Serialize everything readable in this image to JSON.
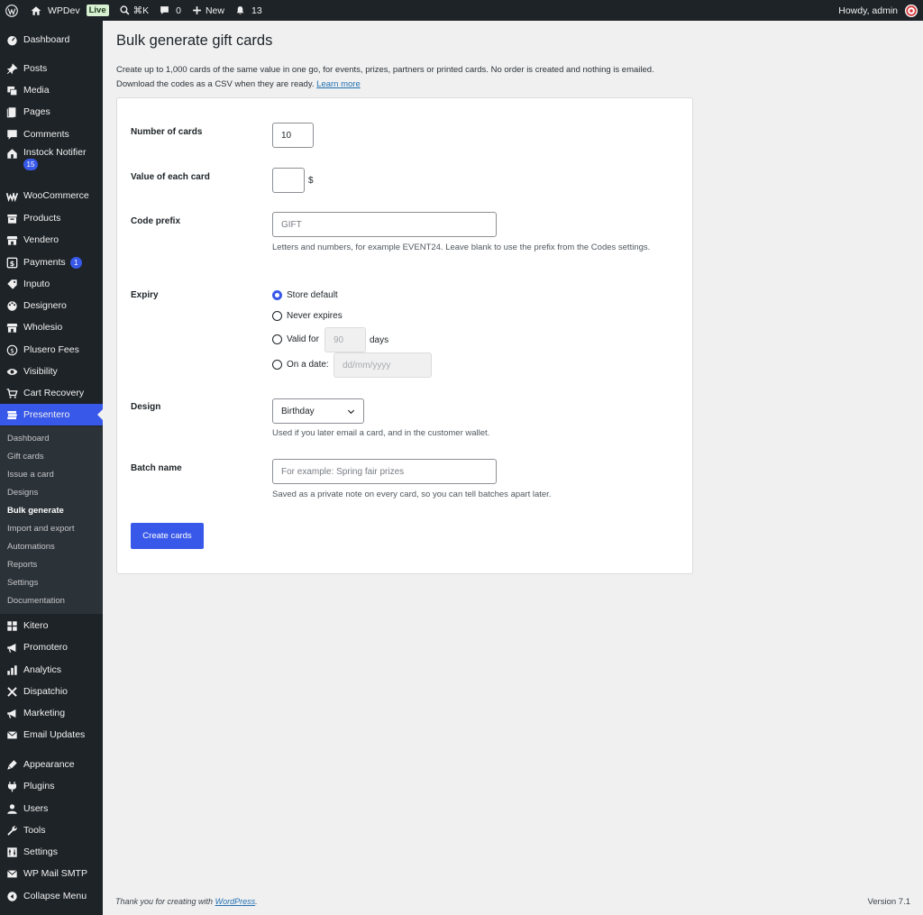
{
  "adminbar": {
    "site_name": "WPDev",
    "live_badge": "Live",
    "shortcut": "⌘K",
    "comments_count": "0",
    "new_label": "New",
    "notifications_count": "13",
    "howdy": "Howdy, admin"
  },
  "sidebar": {
    "items": [
      {
        "label": "Dashboard",
        "icon": "dashboard-icon"
      },
      {
        "label": "Posts",
        "icon": "pin-icon"
      },
      {
        "label": "Media",
        "icon": "media-icon"
      },
      {
        "label": "Pages",
        "icon": "pages-icon"
      },
      {
        "label": "Comments",
        "icon": "comment-icon"
      },
      {
        "label": "Instock Notifier",
        "icon": "store-icon",
        "badge": "15"
      },
      {
        "label": "WooCommerce",
        "icon": "woo-icon"
      },
      {
        "label": "Products",
        "icon": "archive-icon"
      },
      {
        "label": "Vendero",
        "icon": "storefront-icon"
      },
      {
        "label": "Payments",
        "icon": "dollar-box-icon",
        "badge": "1"
      },
      {
        "label": "Inputo",
        "icon": "tag-icon"
      },
      {
        "label": "Designero",
        "icon": "palette-icon"
      },
      {
        "label": "Wholesio",
        "icon": "storefront-icon"
      },
      {
        "label": "Plusero Fees",
        "icon": "dollar-circle-icon"
      },
      {
        "label": "Visibility",
        "icon": "eye-icon"
      },
      {
        "label": "Cart Recovery",
        "icon": "cart-icon"
      },
      {
        "label": "Presentero",
        "icon": "gift-stack-icon"
      },
      {
        "label": "Kitero",
        "icon": "grid-icon"
      },
      {
        "label": "Promotero",
        "icon": "megaphone-icon"
      },
      {
        "label": "Analytics",
        "icon": "bar-chart-icon"
      },
      {
        "label": "Dispatchio",
        "icon": "tools-cross-icon"
      },
      {
        "label": "Marketing",
        "icon": "megaphone-icon"
      },
      {
        "label": "Email Updates",
        "icon": "envelope-icon"
      },
      {
        "label": "Appearance",
        "icon": "brush-icon"
      },
      {
        "label": "Plugins",
        "icon": "plug-icon"
      },
      {
        "label": "Users",
        "icon": "user-icon"
      },
      {
        "label": "Tools",
        "icon": "wrench-icon"
      },
      {
        "label": "Settings",
        "icon": "sliders-icon"
      },
      {
        "label": "WP Mail SMTP",
        "icon": "mail-smtp-icon"
      },
      {
        "label": "Collapse Menu",
        "icon": "collapse-icon"
      }
    ],
    "submenu": [
      "Dashboard",
      "Gift cards",
      "Issue a card",
      "Designs",
      "Bulk generate",
      "Import and export",
      "Automations",
      "Reports",
      "Settings",
      "Documentation"
    ]
  },
  "page": {
    "title": "Bulk generate gift cards",
    "intro_line1": "Create up to 1,000 cards of the same value in one go, for events, prizes, partners or printed cards. No order is created and nothing is emailed.",
    "intro_line2": "Download the codes as a CSV when they are ready.",
    "learn_more": "Learn more"
  },
  "form": {
    "number_label": "Number of cards",
    "number_value": "10",
    "value_label": "Value of each card",
    "value_value": "",
    "currency": "$",
    "prefix_label": "Code prefix",
    "prefix_placeholder": "GIFT",
    "prefix_help": "Letters and numbers, for example EVENT24. Leave blank to use the prefix from the Codes settings.",
    "expiry_label": "Expiry",
    "expiry_options": [
      "Store default",
      "Never expires",
      "Valid for",
      "On a date:"
    ],
    "expiry_selected": "Store default",
    "valid_days_placeholder": "90",
    "days_label": "days",
    "date_placeholder": "dd/mm/yyyy",
    "design_label": "Design",
    "design_value": "Birthday",
    "design_help": "Used if you later email a card, and in the customer wallet.",
    "batch_label": "Batch name",
    "batch_placeholder": "For example: Spring fair prizes",
    "batch_help": "Saved as a private note on every card, so you can tell batches apart later.",
    "submit_label": "Create cards"
  },
  "footer": {
    "thanks_prefix": "Thank you for creating with",
    "wordpress_link": "WordPress",
    "thanks_suffix": ".",
    "version": "Version 7.1"
  },
  "colors": {
    "accent": "#3858e9",
    "sidebar": "#1d2327",
    "submenu": "#2c3338",
    "background": "#f0f0f1"
  }
}
